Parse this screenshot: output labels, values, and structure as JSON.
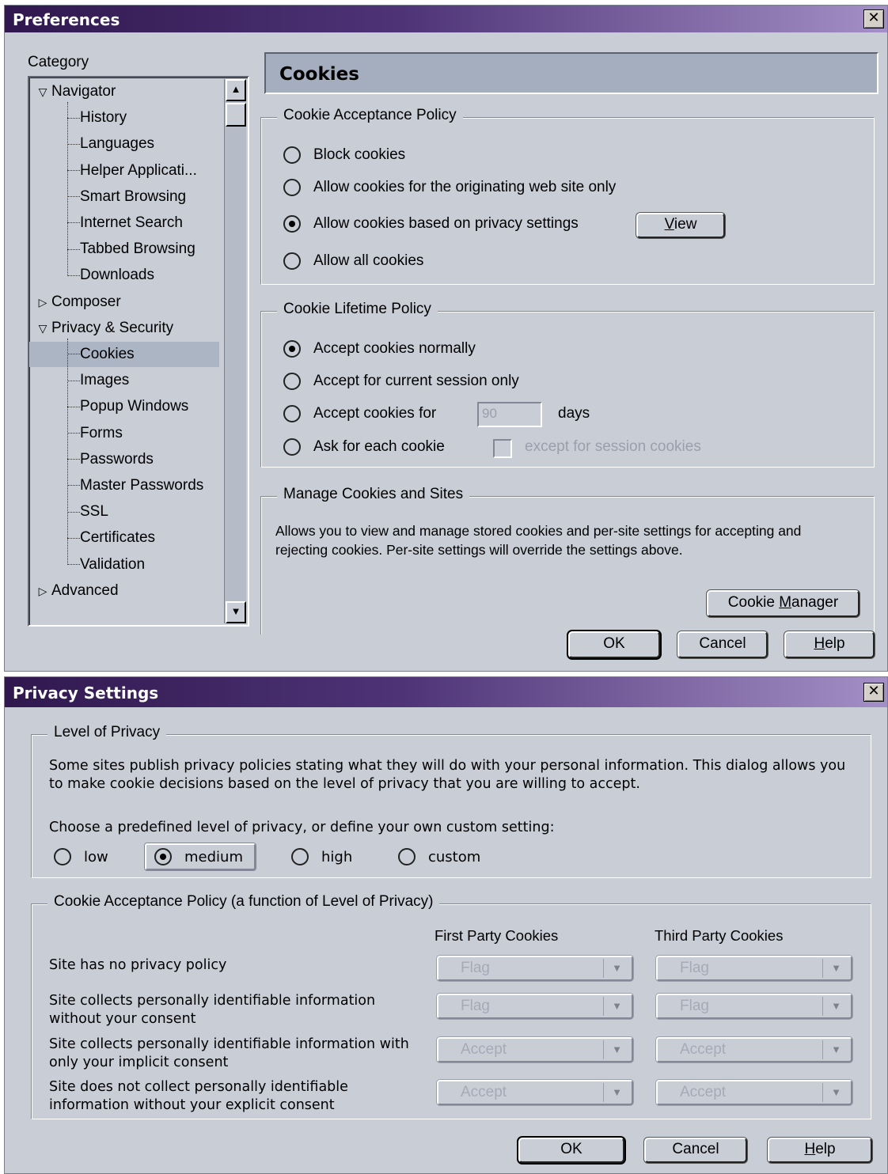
{
  "preferences": {
    "title": "Preferences",
    "category_label": "Category",
    "tree": [
      {
        "label": "Navigator",
        "level": 0,
        "twisty": "expanded"
      },
      {
        "label": "History",
        "level": 1
      },
      {
        "label": "Languages",
        "level": 1
      },
      {
        "label": "Helper Applicati...",
        "level": 1
      },
      {
        "label": "Smart Browsing",
        "level": 1
      },
      {
        "label": "Internet Search",
        "level": 1
      },
      {
        "label": "Tabbed Browsing",
        "level": 1
      },
      {
        "label": "Downloads",
        "level": 1
      },
      {
        "label": "Composer",
        "level": 0,
        "twisty": "collapsed"
      },
      {
        "label": "Privacy & Security",
        "level": 0,
        "twisty": "expanded"
      },
      {
        "label": "Cookies",
        "level": 1,
        "selected": true
      },
      {
        "label": "Images",
        "level": 1
      },
      {
        "label": "Popup Windows",
        "level": 1
      },
      {
        "label": "Forms",
        "level": 1
      },
      {
        "label": "Passwords",
        "level": 1
      },
      {
        "label": "Master Passwords",
        "level": 1
      },
      {
        "label": "SSL",
        "level": 1
      },
      {
        "label": "Certificates",
        "level": 1
      },
      {
        "label": "Validation",
        "level": 1
      },
      {
        "label": "Advanced",
        "level": 0,
        "twisty": "collapsed"
      }
    ],
    "panel_title": "Cookies",
    "acceptance": {
      "title": "Cookie Acceptance Policy",
      "options": [
        "Block cookies",
        "Allow cookies for the originating web site only",
        "Allow cookies based on privacy settings",
        "Allow all cookies"
      ],
      "selected": 2,
      "view_button": "iew",
      "view_accel": "V"
    },
    "lifetime": {
      "title": "Cookie Lifetime Policy",
      "normal": "Accept cookies normally",
      "session": "Accept for current session only",
      "for_days": "Accept cookies for",
      "days_value": "90",
      "days_label": "days",
      "ask": "Ask for each cookie",
      "except": "except for session cookies"
    },
    "manage": {
      "title": "Manage Cookies and Sites",
      "description": "Allows you to view and manage stored cookies and per-site settings for accepting and rejecting cookies. Per-site settings will override the settings above.",
      "button_prefix": "Cookie ",
      "button_accel": "M",
      "button_suffix": "anager"
    },
    "ok": "OK",
    "cancel": "Cancel",
    "help_accel": "H",
    "help_rest": "elp"
  },
  "privacy": {
    "title": "Privacy Settings",
    "level_title": "Level of Privacy",
    "level_desc": "Some sites publish privacy policies stating what they will do with your personal information. This dialog allows you to make cookie decisions based on the level of privacy that you are willing to accept.",
    "choose": "Choose a predefined level of privacy, or define your own custom setting:",
    "levels": [
      "low",
      "medium",
      "high",
      "custom"
    ],
    "selected_level": 1,
    "policy_title": "Cookie Acceptance Policy (a function of Level of Privacy)",
    "col_first": "First Party Cookies",
    "col_third": "Third Party Cookies",
    "rows": [
      {
        "label": "Site has no privacy policy",
        "first": "Flag",
        "third": "Flag"
      },
      {
        "label": "Site collects personally identifiable information without your consent",
        "first": "Flag",
        "third": "Flag"
      },
      {
        "label": "Site collects personally identifiable information with only your implicit consent",
        "first": "Accept",
        "third": "Accept"
      },
      {
        "label": "Site does not collect personally identifiable information without your explicit consent",
        "first": "Accept",
        "third": "Accept"
      }
    ],
    "ok": "OK",
    "cancel": "Cancel",
    "help_accel": "H",
    "help_rest": "elp"
  }
}
